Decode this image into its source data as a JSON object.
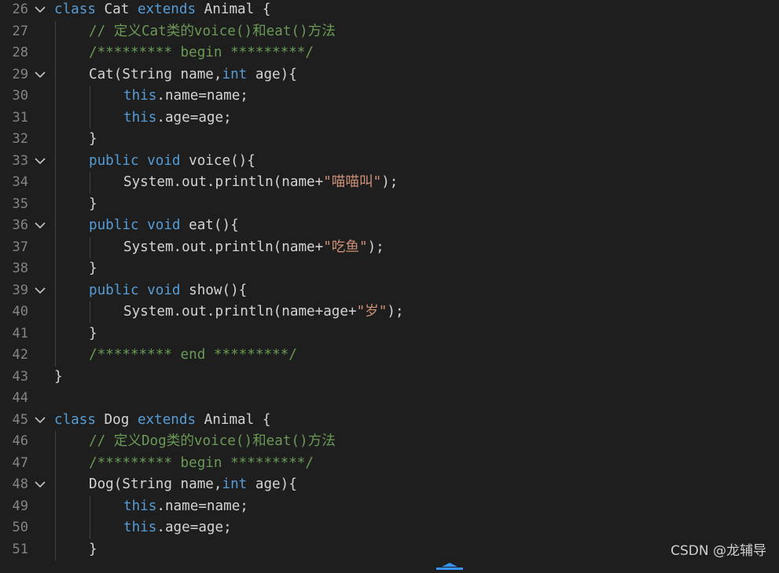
{
  "editor": {
    "lines": [
      {
        "num": "26",
        "fold": true,
        "indent": 0,
        "tokens": [
          [
            "kw",
            "class"
          ],
          [
            "pl",
            " Cat "
          ],
          [
            "kw",
            "extends"
          ],
          [
            "pl",
            " Animal {"
          ]
        ]
      },
      {
        "num": "27",
        "fold": false,
        "indent": 1,
        "tokens": [
          [
            "cm",
            "// 定义Cat类的voice()和eat()方法"
          ]
        ]
      },
      {
        "num": "28",
        "fold": false,
        "indent": 1,
        "tokens": [
          [
            "cm",
            "/********* begin *********/"
          ]
        ]
      },
      {
        "num": "29",
        "fold": true,
        "indent": 1,
        "tokens": [
          [
            "pl",
            "Cat(String name,"
          ],
          [
            "kw",
            "int"
          ],
          [
            "pl",
            " age){"
          ]
        ]
      },
      {
        "num": "30",
        "fold": false,
        "indent": 2,
        "tokens": [
          [
            "kw",
            "this"
          ],
          [
            "pl",
            ".name=name;"
          ]
        ]
      },
      {
        "num": "31",
        "fold": false,
        "indent": 2,
        "tokens": [
          [
            "kw",
            "this"
          ],
          [
            "pl",
            ".age=age;"
          ]
        ]
      },
      {
        "num": "32",
        "fold": false,
        "indent": 1,
        "tokens": [
          [
            "pl",
            "}"
          ]
        ]
      },
      {
        "num": "33",
        "fold": true,
        "indent": 1,
        "tokens": [
          [
            "kw",
            "public"
          ],
          [
            "pl",
            " "
          ],
          [
            "kw",
            "void"
          ],
          [
            "pl",
            " voice(){"
          ]
        ]
      },
      {
        "num": "34",
        "fold": false,
        "indent": 2,
        "tokens": [
          [
            "pl",
            "System.out.println(name+"
          ],
          [
            "st",
            "\"喵喵叫\""
          ],
          [
            "pl",
            ");"
          ]
        ]
      },
      {
        "num": "35",
        "fold": false,
        "indent": 1,
        "tokens": [
          [
            "pl",
            "}"
          ]
        ]
      },
      {
        "num": "36",
        "fold": true,
        "indent": 1,
        "tokens": [
          [
            "kw",
            "public"
          ],
          [
            "pl",
            " "
          ],
          [
            "kw",
            "void"
          ],
          [
            "pl",
            " eat(){"
          ]
        ]
      },
      {
        "num": "37",
        "fold": false,
        "indent": 2,
        "tokens": [
          [
            "pl",
            "System.out.println(name+"
          ],
          [
            "st",
            "\"吃鱼\""
          ],
          [
            "pl",
            ");"
          ]
        ]
      },
      {
        "num": "38",
        "fold": false,
        "indent": 1,
        "tokens": [
          [
            "pl",
            "}"
          ]
        ]
      },
      {
        "num": "39",
        "fold": true,
        "indent": 1,
        "tokens": [
          [
            "kw",
            "public"
          ],
          [
            "pl",
            " "
          ],
          [
            "kw",
            "void"
          ],
          [
            "pl",
            " show(){"
          ]
        ]
      },
      {
        "num": "40",
        "fold": false,
        "indent": 2,
        "tokens": [
          [
            "pl",
            "System.out.println(name+age+"
          ],
          [
            "st",
            "\"岁\""
          ],
          [
            "pl",
            ");"
          ]
        ]
      },
      {
        "num": "41",
        "fold": false,
        "indent": 1,
        "tokens": [
          [
            "pl",
            "}"
          ]
        ]
      },
      {
        "num": "42",
        "fold": false,
        "indent": 1,
        "tokens": [
          [
            "cm",
            "/********* end *********/"
          ]
        ]
      },
      {
        "num": "43",
        "fold": false,
        "indent": 0,
        "tokens": [
          [
            "pl",
            "}"
          ]
        ]
      },
      {
        "num": "44",
        "fold": false,
        "indent": 0,
        "tokens": []
      },
      {
        "num": "45",
        "fold": true,
        "indent": 0,
        "tokens": [
          [
            "kw",
            "class"
          ],
          [
            "pl",
            " Dog "
          ],
          [
            "kw",
            "extends"
          ],
          [
            "pl",
            " Animal {"
          ]
        ]
      },
      {
        "num": "46",
        "fold": false,
        "indent": 1,
        "tokens": [
          [
            "cm",
            "// 定义Dog类的voice()和eat()方法"
          ]
        ]
      },
      {
        "num": "47",
        "fold": false,
        "indent": 1,
        "tokens": [
          [
            "cm",
            "/********* begin *********/"
          ]
        ]
      },
      {
        "num": "48",
        "fold": true,
        "indent": 1,
        "tokens": [
          [
            "pl",
            "Dog(String name,"
          ],
          [
            "kw",
            "int"
          ],
          [
            "pl",
            " age){"
          ]
        ]
      },
      {
        "num": "49",
        "fold": false,
        "indent": 2,
        "tokens": [
          [
            "kw",
            "this"
          ],
          [
            "pl",
            ".name=name;"
          ]
        ]
      },
      {
        "num": "50",
        "fold": false,
        "indent": 2,
        "tokens": [
          [
            "kw",
            "this"
          ],
          [
            "pl",
            ".age=age;"
          ]
        ]
      },
      {
        "num": "51",
        "fold": false,
        "indent": 1,
        "tokens": [
          [
            "pl",
            "}"
          ]
        ]
      }
    ]
  },
  "watermark": "CSDN @龙辅导",
  "colors": {
    "background": "#1e1e1e",
    "keyword": "#569cd6",
    "comment": "#6a9955",
    "string": "#ce9178",
    "text": "#d4d4d4",
    "line_number": "#858585"
  }
}
